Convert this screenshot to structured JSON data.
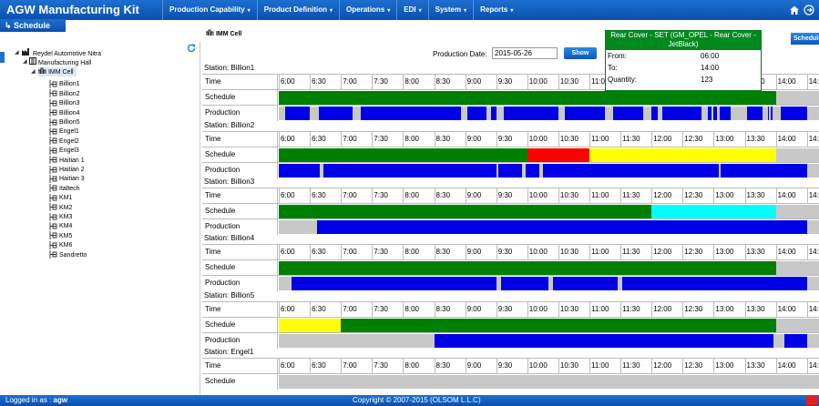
{
  "header": {
    "app_title": "AGW Manufacturing Kit",
    "menus": [
      {
        "label": "Production Capability"
      },
      {
        "label": "Product Definition"
      },
      {
        "label": "Operations"
      },
      {
        "label": "EDI"
      },
      {
        "label": "System"
      },
      {
        "label": "Reports"
      }
    ],
    "home_icon": "home-icon",
    "logout_icon": "logout-icon",
    "schedule_tab": "Schedule"
  },
  "breadcrumb": "IMM Cell",
  "tree": {
    "root": "Reydel Automotive Nitra",
    "hall": "Manufacturing Hall",
    "cell": "IMM Cell",
    "stations": [
      "Billion1",
      "Billion2",
      "Billion3",
      "Billion4",
      "Billion5",
      "Engel1",
      "Engel2",
      "Engel3",
      "Haitian 1",
      "Haitian 2",
      "Haitian 3",
      "Italtech",
      "KM1",
      "KM2",
      "KM3",
      "KM4",
      "KM5",
      "KM6",
      "Sandretto"
    ]
  },
  "filter": {
    "date_label": "Production Date:",
    "date_value": "2015-05-26",
    "show_label": "Show",
    "schedule_button": "Schedule"
  },
  "time_ticks": [
    "6:00",
    "6:30",
    "7:00",
    "7:30",
    "8:00",
    "8:30",
    "9:00",
    "9:30",
    "10:00",
    "10:30",
    "11:00",
    "11:30",
    "12:00",
    "12:30",
    "13:00",
    "13:30",
    "14:00",
    "14:"
  ],
  "row_labels": {
    "time": "Time",
    "schedule": "Schedule",
    "production": "Production"
  },
  "colors": {
    "green": "#008000",
    "blue": "#0000e6",
    "red": "#ff0000",
    "yellow": "#ffff00",
    "cyan": "#00ffff",
    "idle": "#c8c8c8"
  },
  "stations": [
    {
      "label": "Station: Billion1",
      "schedule": [
        {
          "start": "6:00",
          "end": "14:00",
          "color": "green"
        }
      ],
      "production": [
        {
          "start": "6:06",
          "end": "6:30",
          "color": "blue"
        },
        {
          "start": "6:39",
          "end": "7:11",
          "color": "blue"
        },
        {
          "start": "7:19",
          "end": "8:56",
          "color": "blue"
        },
        {
          "start": "9:02",
          "end": "9:21",
          "color": "blue"
        },
        {
          "start": "9:25",
          "end": "9:30",
          "color": "blue"
        },
        {
          "start": "9:37",
          "end": "10:30",
          "color": "blue"
        },
        {
          "start": "10:36",
          "end": "11:15",
          "color": "blue"
        },
        {
          "start": "11:23",
          "end": "11:52",
          "color": "blue"
        },
        {
          "start": "12:00",
          "end": "12:06",
          "color": "blue"
        },
        {
          "start": "12:10",
          "end": "12:48",
          "color": "blue"
        },
        {
          "start": "12:54",
          "end": "12:58",
          "color": "blue"
        },
        {
          "start": "13:00",
          "end": "13:03",
          "color": "blue"
        },
        {
          "start": "13:06",
          "end": "13:16",
          "color": "blue"
        },
        {
          "start": "13:32",
          "end": "13:47",
          "color": "blue"
        },
        {
          "start": "13:52",
          "end": "13:53",
          "color": "blue"
        },
        {
          "start": "13:55",
          "end": "13:57",
          "color": "blue"
        },
        {
          "start": "14:05",
          "end": "14:30",
          "color": "blue"
        }
      ]
    },
    {
      "label": "Station: Billion2",
      "schedule": [
        {
          "start": "6:00",
          "end": "10:00",
          "color": "green"
        },
        {
          "start": "10:00",
          "end": "11:00",
          "color": "red"
        },
        {
          "start": "11:00",
          "end": "14:00",
          "color": "yellow"
        }
      ],
      "production": [
        {
          "start": "6:00",
          "end": "6:40",
          "color": "blue"
        },
        {
          "start": "6:43",
          "end": "9:30",
          "color": "blue"
        },
        {
          "start": "9:32",
          "end": "9:55",
          "color": "blue"
        },
        {
          "start": "9:58",
          "end": "10:12",
          "color": "blue"
        },
        {
          "start": "10:15",
          "end": "13:05",
          "color": "blue"
        },
        {
          "start": "13:07",
          "end": "14:00",
          "color": "blue"
        },
        {
          "start": "14:00",
          "end": "14:30",
          "color": "blue"
        }
      ]
    },
    {
      "label": "Station: Billion3",
      "schedule": [
        {
          "start": "6:00",
          "end": "12:00",
          "color": "green"
        },
        {
          "start": "12:00",
          "end": "14:00",
          "color": "cyan"
        }
      ],
      "production": [
        {
          "start": "6:37",
          "end": "14:00",
          "color": "blue"
        },
        {
          "start": "14:00",
          "end": "14:30",
          "color": "blue"
        }
      ]
    },
    {
      "label": "Station: Billion4",
      "schedule": [
        {
          "start": "6:00",
          "end": "14:00",
          "color": "green"
        }
      ],
      "production": [
        {
          "start": "6:12",
          "end": "9:30",
          "color": "blue"
        },
        {
          "start": "9:35",
          "end": "10:20",
          "color": "blue"
        },
        {
          "start": "10:25",
          "end": "11:27",
          "color": "blue"
        },
        {
          "start": "11:32",
          "end": "14:00",
          "color": "blue"
        },
        {
          "start": "14:00",
          "end": "14:30",
          "color": "blue"
        }
      ]
    },
    {
      "label": "Station: Billion5",
      "schedule": [
        {
          "start": "6:00",
          "end": "7:00",
          "color": "yellow"
        },
        {
          "start": "7:00",
          "end": "14:00",
          "color": "green"
        }
      ],
      "production": [
        {
          "start": "8:30",
          "end": "13:58",
          "color": "blue"
        },
        {
          "start": "14:08",
          "end": "14:30",
          "color": "blue"
        }
      ]
    },
    {
      "label": "Station: Engel1",
      "schedule": [],
      "production": []
    }
  ],
  "tooltip": {
    "title": "Rear Cover - SET (GM_OPEL - Rear Cover - JetBlack)",
    "from_label": "From:",
    "from_value": "06:00",
    "to_label": "To:",
    "to_value": "14:00",
    "qty_label": "Quantity:",
    "qty_value": "123"
  },
  "footer": {
    "login_prefix": "Logged in as :",
    "user": "agw",
    "copyright": "Copyright © 2007-2015 (OLSOM L.L.C)"
  }
}
